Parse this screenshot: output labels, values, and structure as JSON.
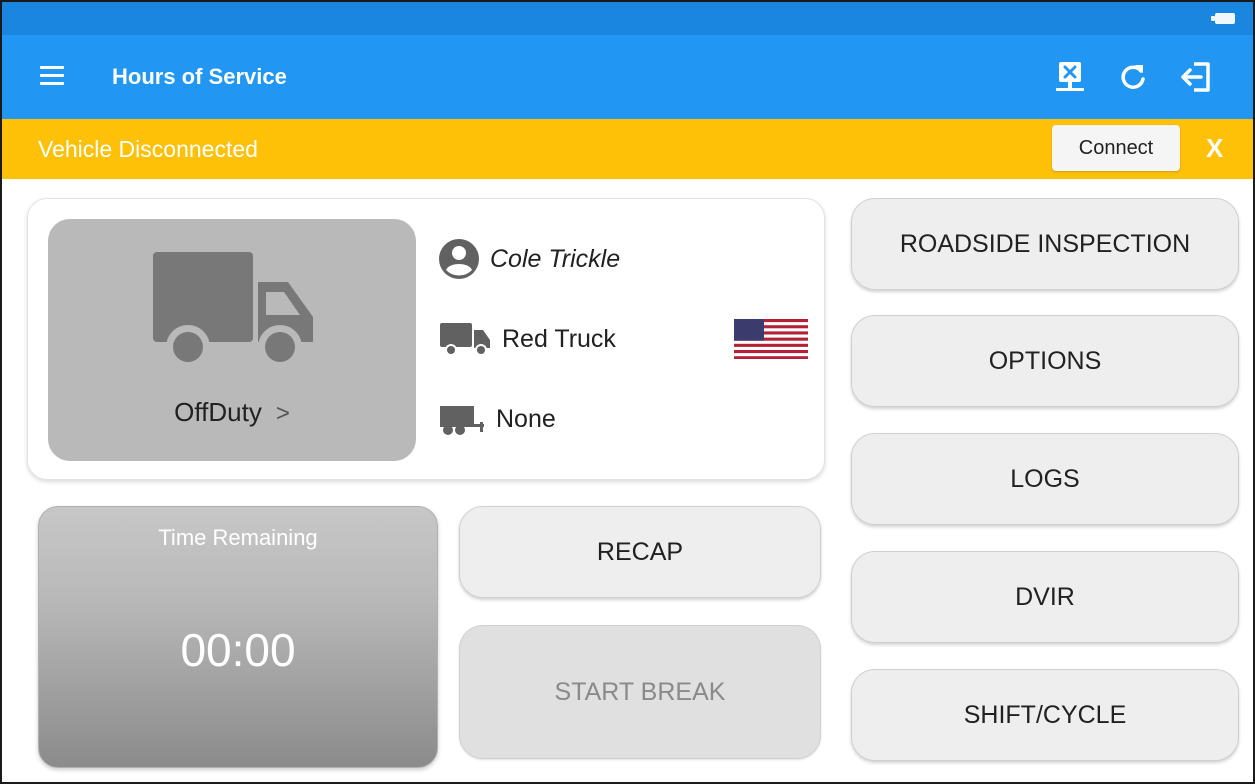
{
  "app": {
    "title": "Hours of Service"
  },
  "banner": {
    "message": "Vehicle Disconnected",
    "connect_label": "Connect",
    "close_label": "X"
  },
  "driver": {
    "name": "Cole Trickle",
    "vehicle": "Red Truck",
    "trailer": "None",
    "status": "OffDuty",
    "status_chevron": ">",
    "country_flag": "us-flag-icon"
  },
  "time_remaining": {
    "title": "Time Remaining",
    "value": "00:00"
  },
  "actions": {
    "recap": "RECAP",
    "start_break": "START BREAK",
    "roadside_inspection": "ROADSIDE INSPECTION",
    "options": "OPTIONS",
    "logs": "LOGS",
    "dvir": "DVIR",
    "shift_cycle": "SHIFT/CYCLE"
  },
  "colors": {
    "statusbar": "#1a86e0",
    "appbar": "#2196f3",
    "banner": "#ffc107",
    "status_tile": "#b9b9b9"
  }
}
